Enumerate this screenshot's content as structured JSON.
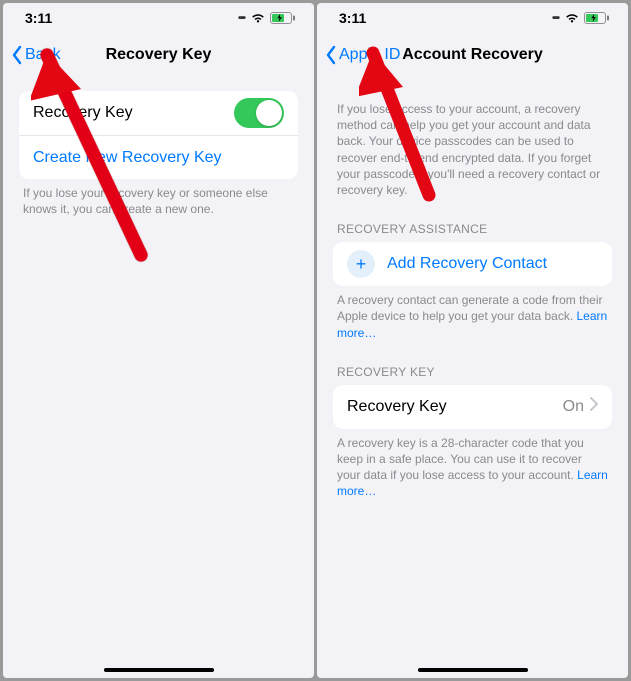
{
  "left": {
    "status": {
      "time": "3:11"
    },
    "nav": {
      "back": "Back",
      "title": "Recovery Key"
    },
    "rows": {
      "recovery_key_label": "Recovery Key",
      "create_new_label": "Create New Recovery Key"
    },
    "footer": "If you lose your recovery key or someone else knows it, you can create a new one."
  },
  "right": {
    "status": {
      "time": "3:11"
    },
    "nav": {
      "back": "Apple ID",
      "title": "Account Recovery"
    },
    "intro": "If you lose access to your account, a recovery method can help you get your account and data back. Your device passcodes can be used to recover end-to-end encrypted data. If you forget your passcodes, you'll need a recovery contact or recovery key.",
    "sections": {
      "assistance_header": "RECOVERY ASSISTANCE",
      "add_contact_label": "Add Recovery Contact",
      "assistance_footer": "A recovery contact can generate a code from their Apple device to help you get your data back. ",
      "assistance_footer_link": "Learn more…",
      "key_header": "RECOVERY KEY",
      "key_row_label": "Recovery Key",
      "key_row_value": "On",
      "key_footer": "A recovery key is a 28-character code that you keep in a safe place. You can use it to recover your data if you lose access to your account. ",
      "key_footer_link": "Learn more…"
    }
  }
}
